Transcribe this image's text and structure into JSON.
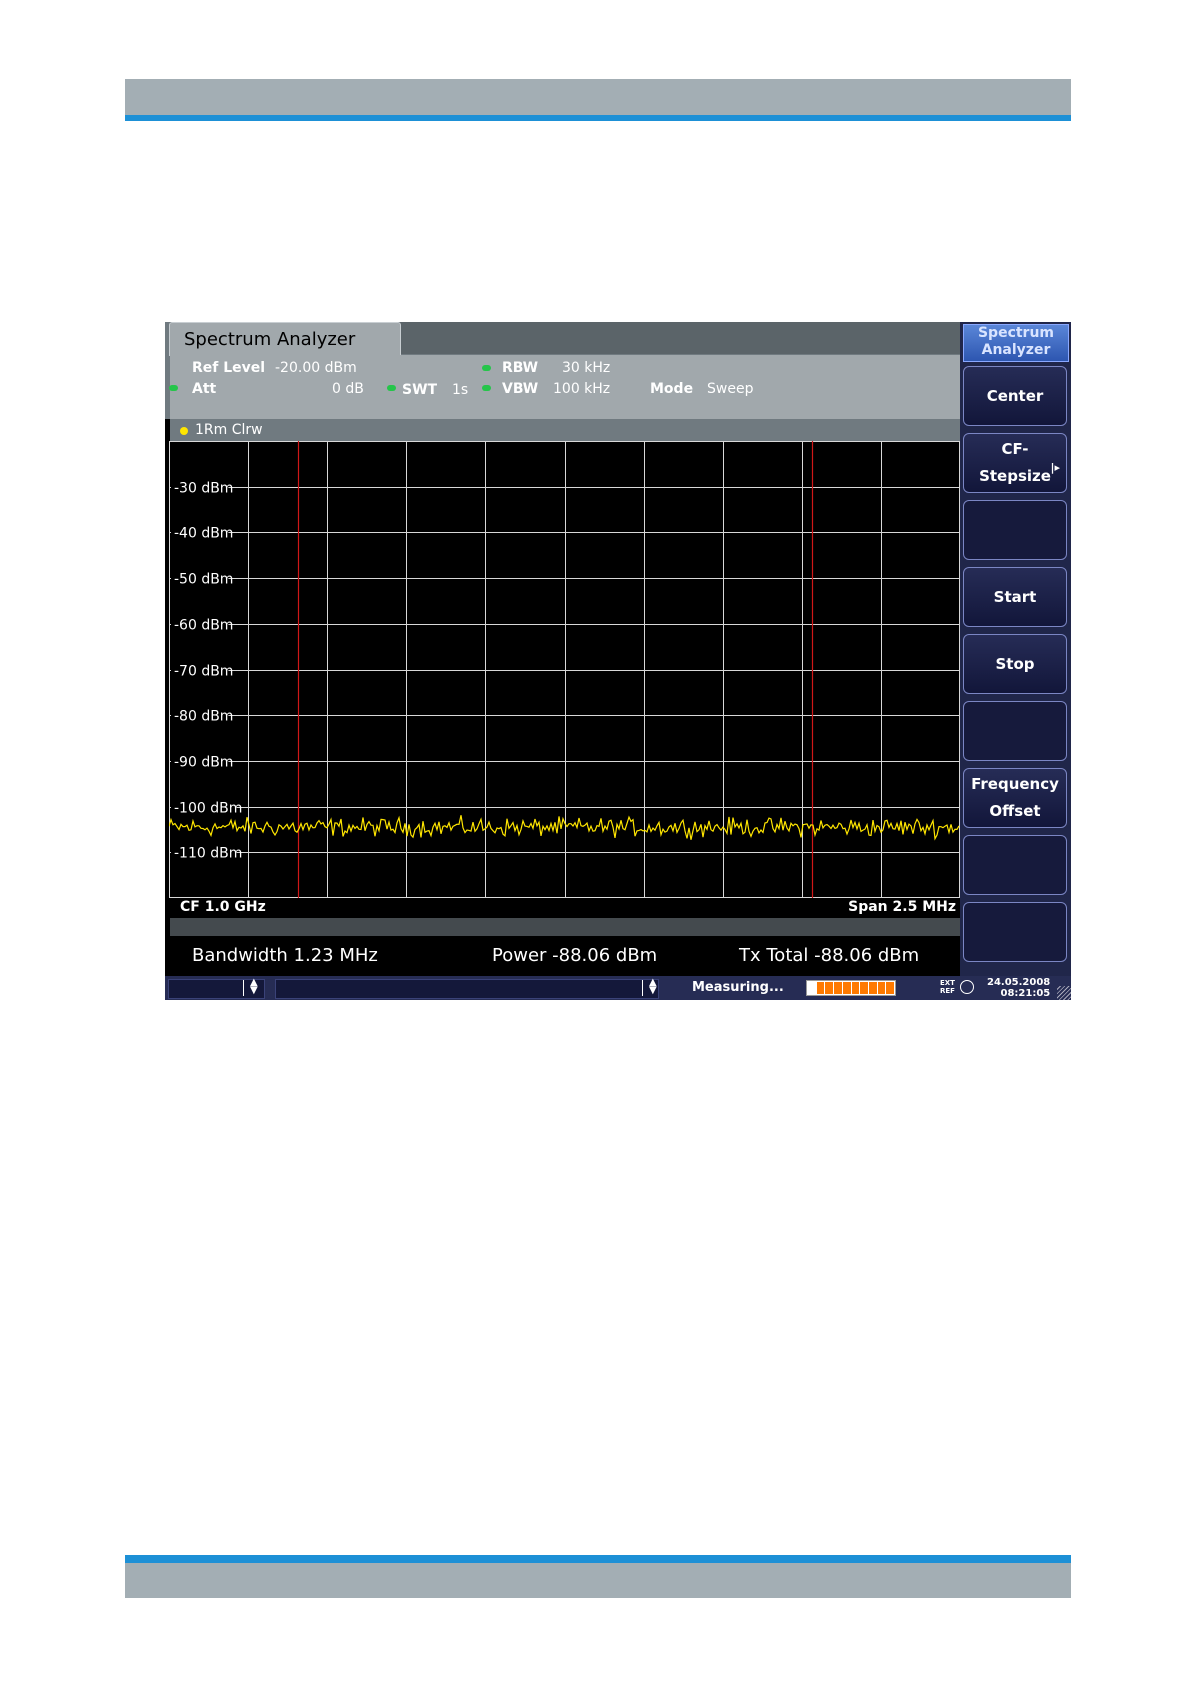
{
  "screen": {
    "app_tab": "Spectrum Analyzer",
    "settings": {
      "ref_level_label": "Ref Level",
      "ref_level_value": "-20.00 dBm",
      "att_label": "Att",
      "att_value": "0 dB",
      "swt_label": "SWT",
      "swt_value": "1s",
      "rbw_label": "RBW",
      "rbw_value": "30 kHz",
      "vbw_label": "VBW",
      "vbw_value": "100 kHz",
      "mode_label": "Mode",
      "mode_value": "Sweep"
    },
    "trace_label": "1Rm Clrw",
    "colors": {
      "trace": "#ffe600",
      "marker_lines": "#d01818",
      "grid": "#d8d8d8",
      "softkey_title": "#3a67c4",
      "progress": "#ff7a00",
      "led": "#25c54a"
    },
    "cf_label": "CF 1.0 GHz",
    "span_label": "Span 2.5 MHz",
    "results": {
      "bandwidth": "Bandwidth  1.23 MHz",
      "power": "Power  -88.06 dBm",
      "tx_total": "Tx Total  -88.06 dBm"
    },
    "softkeys": {
      "title_line1": "Spectrum",
      "title_line2": "Analyzer",
      "center": "Center",
      "cf_stepsize_line1": "CF-",
      "cf_stepsize_line2": "Stepsize",
      "start": "Start",
      "stop": "Stop",
      "freq_offset_line1": "Frequency",
      "freq_offset_line2": "Offset"
    },
    "status": {
      "text": "Measuring...",
      "progress": 0.85,
      "ext_ref_line1": "EXT",
      "ext_ref_line2": "REF",
      "date": "24.05.2008",
      "time": "08:21:05"
    }
  },
  "chart_data": {
    "type": "line",
    "title": "",
    "xlabel": "",
    "ylabel": "",
    "x_center": "CF 1.0 GHz",
    "x_span": "Span 2.5 MHz",
    "y_ticks": [
      "-30 dBm",
      "-40 dBm",
      "-50 dBm",
      "-60 dBm",
      "-70 dBm",
      "-80 dBm",
      "-90 dBm",
      "-100 dBm",
      "-110 dBm"
    ],
    "ylim": [
      -120,
      -20
    ],
    "grid": true,
    "vertical_markers": [
      -0.675,
      0.625
    ],
    "series": [
      {
        "trace_level_dbm": -104.5,
        "noise_amplitude_db": 1.5
      }
    ]
  }
}
